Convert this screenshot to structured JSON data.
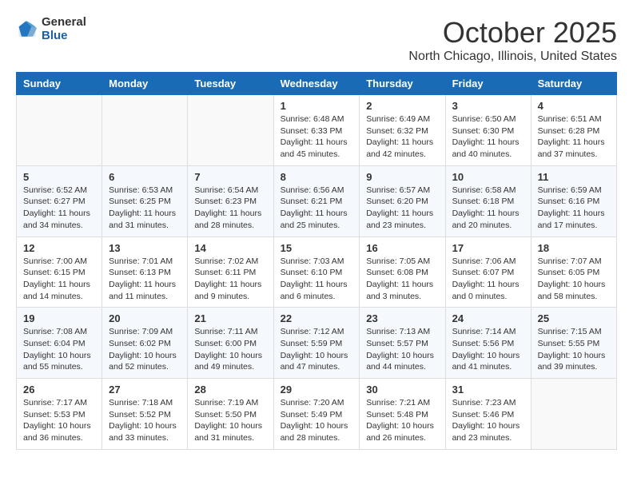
{
  "logo": {
    "general": "General",
    "blue": "Blue"
  },
  "title": "October 2025",
  "location": "North Chicago, Illinois, United States",
  "days_of_week": [
    "Sunday",
    "Monday",
    "Tuesday",
    "Wednesday",
    "Thursday",
    "Friday",
    "Saturday"
  ],
  "weeks": [
    [
      {
        "day": "",
        "info": ""
      },
      {
        "day": "",
        "info": ""
      },
      {
        "day": "",
        "info": ""
      },
      {
        "day": "1",
        "info": "Sunrise: 6:48 AM\nSunset: 6:33 PM\nDaylight: 11 hours\nand 45 minutes."
      },
      {
        "day": "2",
        "info": "Sunrise: 6:49 AM\nSunset: 6:32 PM\nDaylight: 11 hours\nand 42 minutes."
      },
      {
        "day": "3",
        "info": "Sunrise: 6:50 AM\nSunset: 6:30 PM\nDaylight: 11 hours\nand 40 minutes."
      },
      {
        "day": "4",
        "info": "Sunrise: 6:51 AM\nSunset: 6:28 PM\nDaylight: 11 hours\nand 37 minutes."
      }
    ],
    [
      {
        "day": "5",
        "info": "Sunrise: 6:52 AM\nSunset: 6:27 PM\nDaylight: 11 hours\nand 34 minutes."
      },
      {
        "day": "6",
        "info": "Sunrise: 6:53 AM\nSunset: 6:25 PM\nDaylight: 11 hours\nand 31 minutes."
      },
      {
        "day": "7",
        "info": "Sunrise: 6:54 AM\nSunset: 6:23 PM\nDaylight: 11 hours\nand 28 minutes."
      },
      {
        "day": "8",
        "info": "Sunrise: 6:56 AM\nSunset: 6:21 PM\nDaylight: 11 hours\nand 25 minutes."
      },
      {
        "day": "9",
        "info": "Sunrise: 6:57 AM\nSunset: 6:20 PM\nDaylight: 11 hours\nand 23 minutes."
      },
      {
        "day": "10",
        "info": "Sunrise: 6:58 AM\nSunset: 6:18 PM\nDaylight: 11 hours\nand 20 minutes."
      },
      {
        "day": "11",
        "info": "Sunrise: 6:59 AM\nSunset: 6:16 PM\nDaylight: 11 hours\nand 17 minutes."
      }
    ],
    [
      {
        "day": "12",
        "info": "Sunrise: 7:00 AM\nSunset: 6:15 PM\nDaylight: 11 hours\nand 14 minutes."
      },
      {
        "day": "13",
        "info": "Sunrise: 7:01 AM\nSunset: 6:13 PM\nDaylight: 11 hours\nand 11 minutes."
      },
      {
        "day": "14",
        "info": "Sunrise: 7:02 AM\nSunset: 6:11 PM\nDaylight: 11 hours\nand 9 minutes."
      },
      {
        "day": "15",
        "info": "Sunrise: 7:03 AM\nSunset: 6:10 PM\nDaylight: 11 hours\nand 6 minutes."
      },
      {
        "day": "16",
        "info": "Sunrise: 7:05 AM\nSunset: 6:08 PM\nDaylight: 11 hours\nand 3 minutes."
      },
      {
        "day": "17",
        "info": "Sunrise: 7:06 AM\nSunset: 6:07 PM\nDaylight: 11 hours\nand 0 minutes."
      },
      {
        "day": "18",
        "info": "Sunrise: 7:07 AM\nSunset: 6:05 PM\nDaylight: 10 hours\nand 58 minutes."
      }
    ],
    [
      {
        "day": "19",
        "info": "Sunrise: 7:08 AM\nSunset: 6:04 PM\nDaylight: 10 hours\nand 55 minutes."
      },
      {
        "day": "20",
        "info": "Sunrise: 7:09 AM\nSunset: 6:02 PM\nDaylight: 10 hours\nand 52 minutes."
      },
      {
        "day": "21",
        "info": "Sunrise: 7:11 AM\nSunset: 6:00 PM\nDaylight: 10 hours\nand 49 minutes."
      },
      {
        "day": "22",
        "info": "Sunrise: 7:12 AM\nSunset: 5:59 PM\nDaylight: 10 hours\nand 47 minutes."
      },
      {
        "day": "23",
        "info": "Sunrise: 7:13 AM\nSunset: 5:57 PM\nDaylight: 10 hours\nand 44 minutes."
      },
      {
        "day": "24",
        "info": "Sunrise: 7:14 AM\nSunset: 5:56 PM\nDaylight: 10 hours\nand 41 minutes."
      },
      {
        "day": "25",
        "info": "Sunrise: 7:15 AM\nSunset: 5:55 PM\nDaylight: 10 hours\nand 39 minutes."
      }
    ],
    [
      {
        "day": "26",
        "info": "Sunrise: 7:17 AM\nSunset: 5:53 PM\nDaylight: 10 hours\nand 36 minutes."
      },
      {
        "day": "27",
        "info": "Sunrise: 7:18 AM\nSunset: 5:52 PM\nDaylight: 10 hours\nand 33 minutes."
      },
      {
        "day": "28",
        "info": "Sunrise: 7:19 AM\nSunset: 5:50 PM\nDaylight: 10 hours\nand 31 minutes."
      },
      {
        "day": "29",
        "info": "Sunrise: 7:20 AM\nSunset: 5:49 PM\nDaylight: 10 hours\nand 28 minutes."
      },
      {
        "day": "30",
        "info": "Sunrise: 7:21 AM\nSunset: 5:48 PM\nDaylight: 10 hours\nand 26 minutes."
      },
      {
        "day": "31",
        "info": "Sunrise: 7:23 AM\nSunset: 5:46 PM\nDaylight: 10 hours\nand 23 minutes."
      },
      {
        "day": "",
        "info": ""
      }
    ]
  ]
}
